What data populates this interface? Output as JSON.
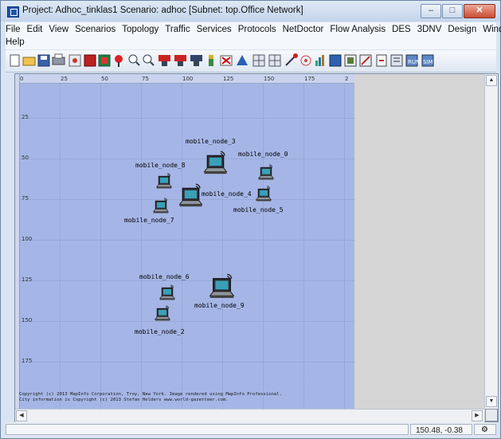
{
  "window": {
    "title": "Project: Adhoc_tinklas1 Scenario: adhoc  [Subnet: top.Office Network]",
    "controls": [
      "minimize",
      "maximize",
      "close"
    ]
  },
  "menu": {
    "items": [
      "File",
      "Edit",
      "View",
      "Scenarios",
      "Topology",
      "Traffic",
      "Services",
      "Protocols",
      "NetDoctor",
      "Flow Analysis",
      "DES",
      "3DNV",
      "Design",
      "Windows",
      "Help"
    ]
  },
  "toolbar": {
    "icons": [
      "new-icon",
      "open-icon",
      "save-icon",
      "print-icon",
      "node-palette-icon",
      "device-icon",
      "device2-icon",
      "marker-icon",
      "zoom-in-icon",
      "zoom-out-icon",
      "traffic-ace-icon",
      "traffic-dt-icon",
      "traffic-vne-icon",
      "configure-icon",
      "failure-icon",
      "recover-icon",
      "grid-icon",
      "grid2-icon",
      "flow-icon",
      "wireless-icon",
      "plot-icon",
      "statistics-icon",
      "results-icon",
      "edit-attributes-icon",
      "view-results-icon",
      "report-icon",
      "run-icon",
      "simulation-icon"
    ]
  },
  "ruler": {
    "x_ticks": [
      "0",
      "25",
      "50",
      "75",
      "100",
      "125",
      "150",
      "175",
      "2"
    ],
    "y_ticks": [
      "25",
      "50",
      "75",
      "100",
      "125",
      "150",
      "175"
    ]
  },
  "nodes": [
    {
      "label": "mobile_node_3"
    },
    {
      "label": "mobile_node_0"
    },
    {
      "label": "mobile_node_8"
    },
    {
      "label": "mobile_node_4"
    },
    {
      "label": "mobile_node_5"
    },
    {
      "label": "mobile_node_7"
    },
    {
      "label": "mobile_node_6"
    },
    {
      "label": "mobile_node_9"
    },
    {
      "label": "mobile_node_2"
    }
  ],
  "copyright": {
    "line1": "Copyright (c) 2013 MapInfo Corporation, Troy, New York. Image rendered using MapInfo Professional.",
    "line2": "City information is Copyright (c) 2013 Stefan Helders www.world-gazetteer.com."
  },
  "status": {
    "coordinates": "150.48, -0.38"
  },
  "colors": {
    "map_background": "#a5b6e6",
    "titlebar": "#c3d4ea",
    "close_button": "#c94b32"
  }
}
